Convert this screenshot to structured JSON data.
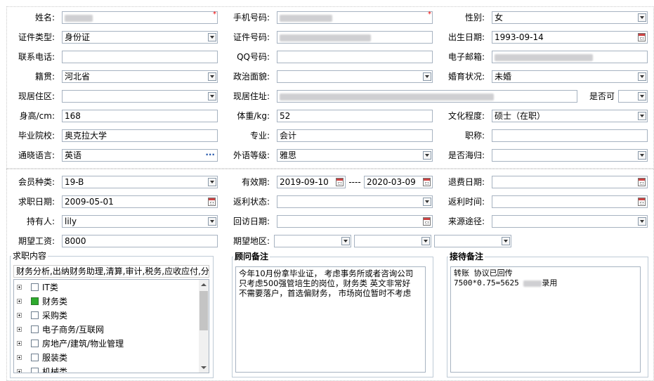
{
  "form": {
    "name_label": "姓名:",
    "phone_label": "手机号码:",
    "gender_label": "性别:",
    "gender_value": "女",
    "idtype_label": "证件类型:",
    "idtype_value": "身份证",
    "idnum_label": "证件号码:",
    "birth_label": "出生日期:",
    "birth_value": "1993-09-14",
    "contact_label": "联系电话:",
    "qq_label": "QQ号码:",
    "email_label": "电子邮箱:",
    "native_label": "籍贯:",
    "native_value": "河北省",
    "political_label": "政治面貌:",
    "marital_label": "婚育状况:",
    "marital_value": "未婚",
    "district_label": "现居住区:",
    "address_label": "现居住址:",
    "shifou_label": "是否可",
    "height_label": "身高/cm:",
    "height_value": "168",
    "weight_label": "体重/kg:",
    "weight_value": "52",
    "edu_label": "文化程度:",
    "edu_value": "硕士（在职）",
    "school_label": "毕业院校:",
    "school_value": "奥克拉大学",
    "major_label": "专业:",
    "major_value": "会计",
    "title_label": "职称:",
    "lang_label": "通晓语言:",
    "lang_value": "英语",
    "langlevel_label": "外语等级:",
    "langlevel_value": "雅思",
    "returnee_label": "是否海归:"
  },
  "member": {
    "type_label": "会员种类:",
    "type_value": "19-B",
    "valid_label": "有效期:",
    "valid_from": "2019-09-10",
    "valid_sep": "----",
    "valid_to": "2020-03-09",
    "refund_label": "退费日期:",
    "jobdate_label": "求职日期:",
    "jobdate_value": "2009-05-01",
    "rebate_status_label": "返利状态:",
    "rebate_time_label": "返利时间:",
    "holder_label": "持有人:",
    "holder_value": "lily",
    "visit_label": "回访日期:",
    "source_label": "来源途径:",
    "salary_label": "期望工资:",
    "salary_value": "8000",
    "region_label": "期望地区:"
  },
  "job": {
    "title": "求职内容",
    "summary": "财务分析,出纳财务助理,清算,审计,税务,应收应付,分",
    "tree": [
      {
        "label": "IT类",
        "checked": false
      },
      {
        "label": "财务类",
        "checked": true
      },
      {
        "label": "采购类",
        "checked": false
      },
      {
        "label": "电子商务/互联网",
        "checked": false
      },
      {
        "label": "房地产/建筑/物业管理",
        "checked": false
      },
      {
        "label": "服装类",
        "checked": false
      },
      {
        "label": "机械类",
        "checked": false
      }
    ]
  },
  "advisor": {
    "title": "顾问备注",
    "lines": [
      "今年10月份拿毕业证， 考虑事务所或者咨询公司",
      "只考虑500强管培生的岗位，财务类 英文非常好",
      "不需要落户，首选偏财务， 市场岗位暂时不考虑"
    ]
  },
  "reception": {
    "title": "接待备注",
    "line1": "转账 协议已回传",
    "line2": "7500*0.75=5625",
    "line2_suffix": "录用"
  },
  "colors": {
    "required": "#ee0000",
    "border": "#a7b3c1",
    "checked": "#2eaa2e"
  }
}
